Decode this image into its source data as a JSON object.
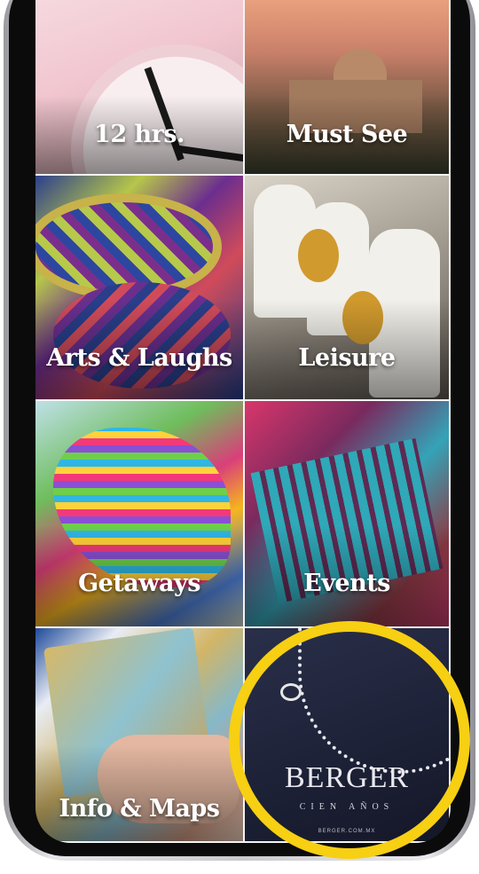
{
  "tiles": {
    "twelve_hours": "12 hrs.",
    "must_see": "Must See",
    "arts_laughs": "Arts & Laughs",
    "leisure": "Leisure",
    "getaways": "Getaways",
    "events": "Events",
    "info_maps": "Info & Maps"
  },
  "sponsor": {
    "name": "BERGER",
    "tagline": "CIEN AÑOS",
    "url": "BERGER.COM.MX"
  },
  "colors": {
    "highlight": "#f7cf13",
    "label_text": "#ffffff"
  }
}
